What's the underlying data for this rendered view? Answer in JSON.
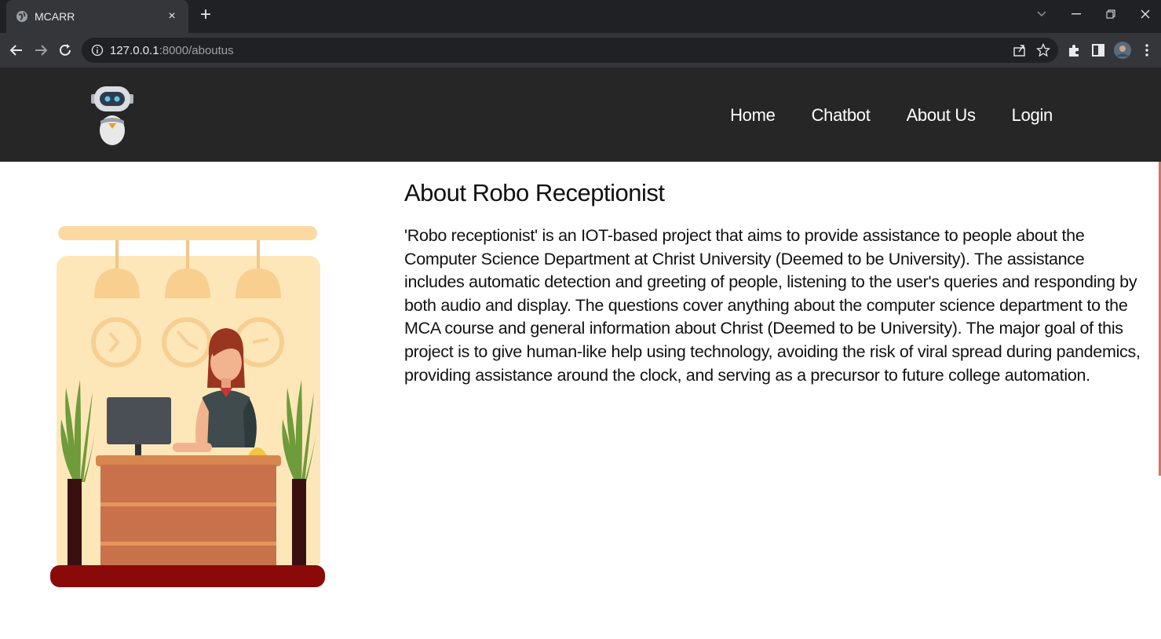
{
  "browser": {
    "tab_title": "MCARR",
    "tab_close": "×",
    "new_tab": "+",
    "url_host": "127.0.0.1",
    "url_path": ":8000/aboutus"
  },
  "site": {
    "nav": [
      "Home",
      "Chatbot",
      "About Us",
      "Login"
    ]
  },
  "about": {
    "heading": "About Robo Receptionist",
    "body": "'Robo receptionist' is an IOT-based project that aims to provide assistance to people about the Computer Science Department at Christ University (Deemed to be University). The assistance includes automatic detection and greeting of people, listening to the user's queries and responding by both audio and display. The questions cover anything about the computer science department to the MCA course and general information about Christ (Deemed to be University). The major goal of this project is to give human-like help using technology, avoiding the risk of viral spread during pandemics, providing assistance around the clock, and serving as a precursor to future college automation."
  },
  "colors": {
    "chrome_dark": "#202124",
    "chrome_tab": "#35363a",
    "site_nav": "#262626"
  },
  "icons": [
    "globe-icon",
    "close-icon",
    "plus-icon",
    "chevron-down-icon",
    "minimize-icon",
    "restore-icon",
    "window-close-icon",
    "back-icon",
    "forward-icon",
    "reload-icon",
    "info-icon",
    "share-icon",
    "star-icon",
    "extensions-icon",
    "sidepanel-icon",
    "profile-avatar",
    "menu-icon",
    "robot-logo"
  ]
}
